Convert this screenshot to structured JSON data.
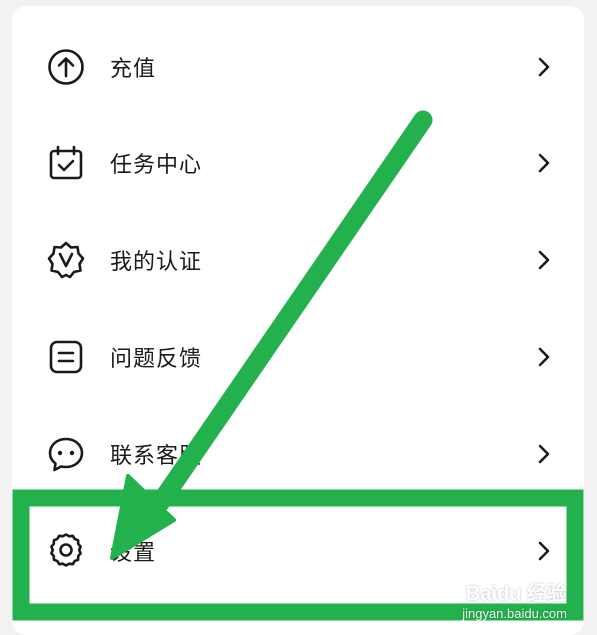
{
  "menu": {
    "items": [
      {
        "label": "充值",
        "icon": "upload-arrow-circle-icon"
      },
      {
        "label": "任务中心",
        "icon": "calendar-check-icon"
      },
      {
        "label": "我的认证",
        "icon": "verified-badge-icon"
      },
      {
        "label": "问题反馈",
        "icon": "feedback-note-icon"
      },
      {
        "label": "联系客服",
        "icon": "chat-bubble-icon"
      },
      {
        "label": "设置",
        "icon": "gear-icon"
      }
    ]
  },
  "annotation": {
    "color": "#22b14c"
  },
  "watermark": {
    "brand": "Baidu 经验",
    "domain": "jingyan.baidu.com"
  }
}
